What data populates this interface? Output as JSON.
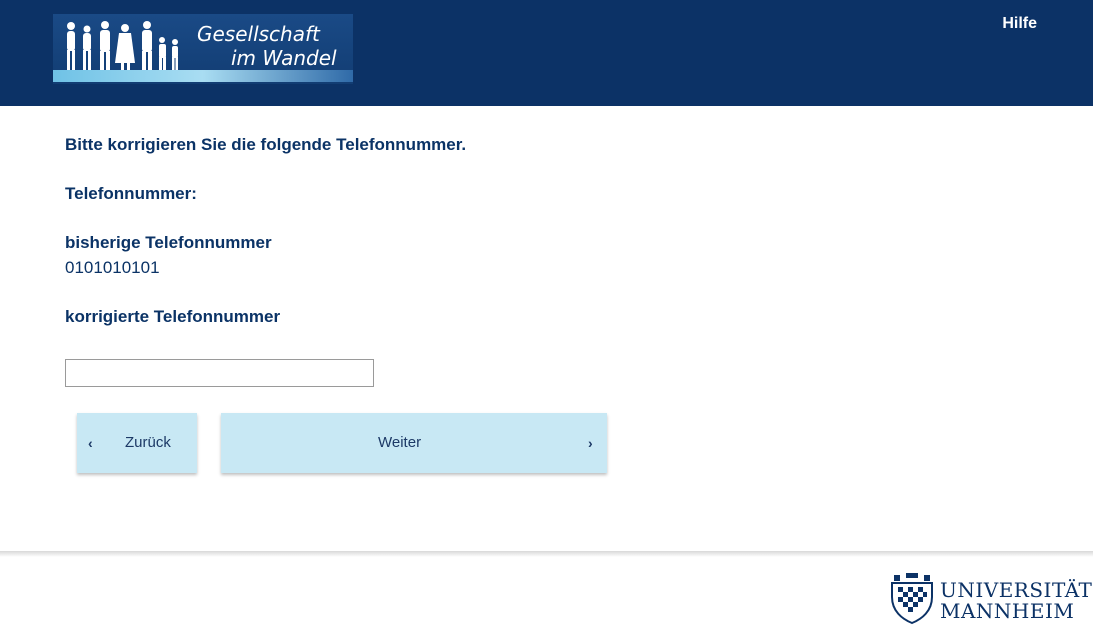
{
  "header": {
    "logo_line1": "Gesellschaft",
    "logo_line2": "im Wandel",
    "help_label": "Hilfe"
  },
  "question": {
    "instruction": "Bitte korrigieren Sie die folgende Telefonnummer.",
    "phone_label": "Telefonnummer:",
    "previous_label": "bisherige Telefonnummer",
    "previous_value": "0101010101",
    "corrected_label": "korrigierte Telefonnummer",
    "corrected_value": ""
  },
  "nav": {
    "back_label": "Zurück",
    "next_label": "Weiter"
  },
  "footer": {
    "uni_line1": "UNIVERSITÄT",
    "uni_line2": "MANNHEIM"
  },
  "colors": {
    "header_bg": "#0c3266",
    "button_bg": "#c8e8f4",
    "text": "#0b3366"
  }
}
